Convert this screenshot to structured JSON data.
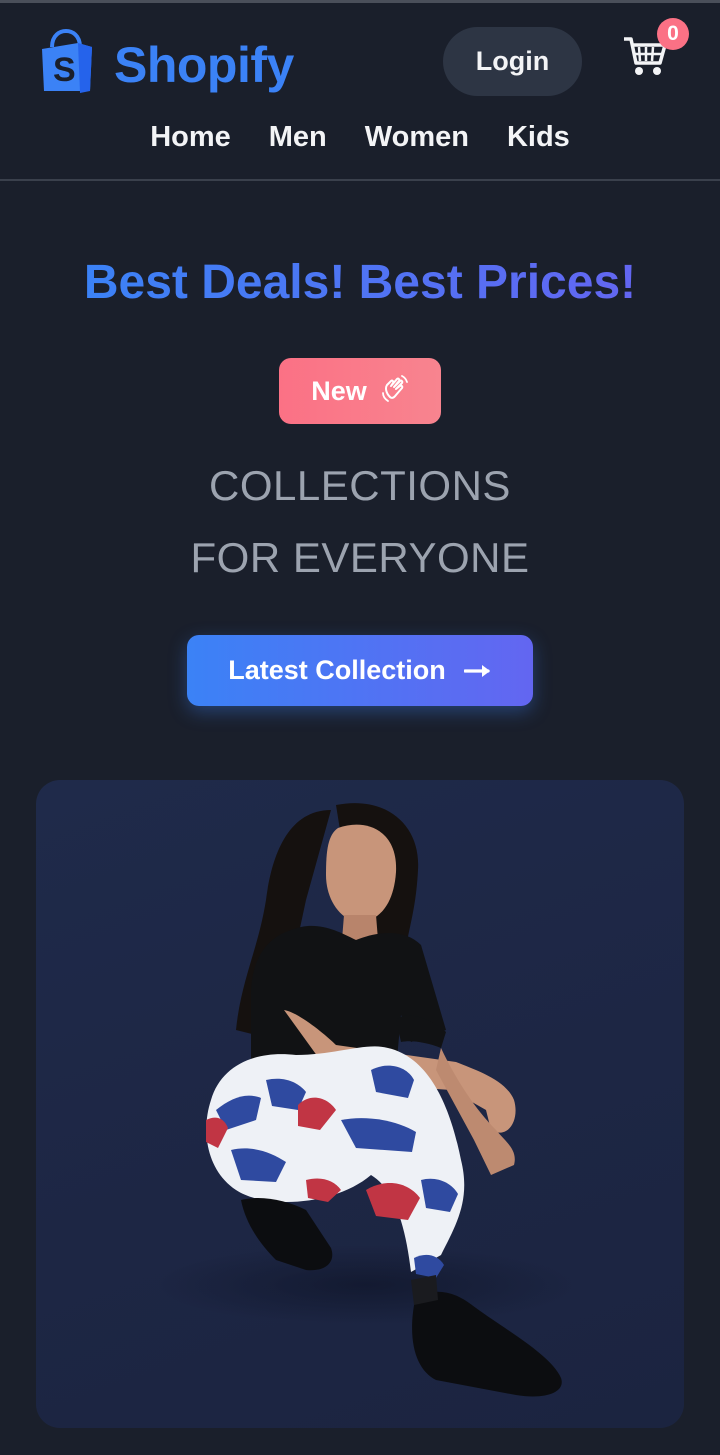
{
  "header": {
    "brand": "Shopify",
    "login_label": "Login",
    "cart_count": "0",
    "nav": [
      "Home",
      "Men",
      "Women",
      "Kids"
    ]
  },
  "hero": {
    "headline": "Best Deals! Best Prices!",
    "badge_label": "New",
    "subtitle_line1": "COLLECTIONS",
    "subtitle_line2": "FOR EVERYONE",
    "cta_label": "Latest Collection"
  },
  "icons": {
    "logo": "shopping-bag-icon",
    "cart": "shopping-cart-icon",
    "badge": "waving-hand-icon",
    "cta": "arrow-right-icon"
  },
  "colors": {
    "background": "#1a1f2b",
    "brand": "#3b82f6",
    "accent_gradient_end": "#6366f1",
    "badge": "#fb7185",
    "button_dark": "#2d3544",
    "muted_text": "#9ca3af"
  }
}
